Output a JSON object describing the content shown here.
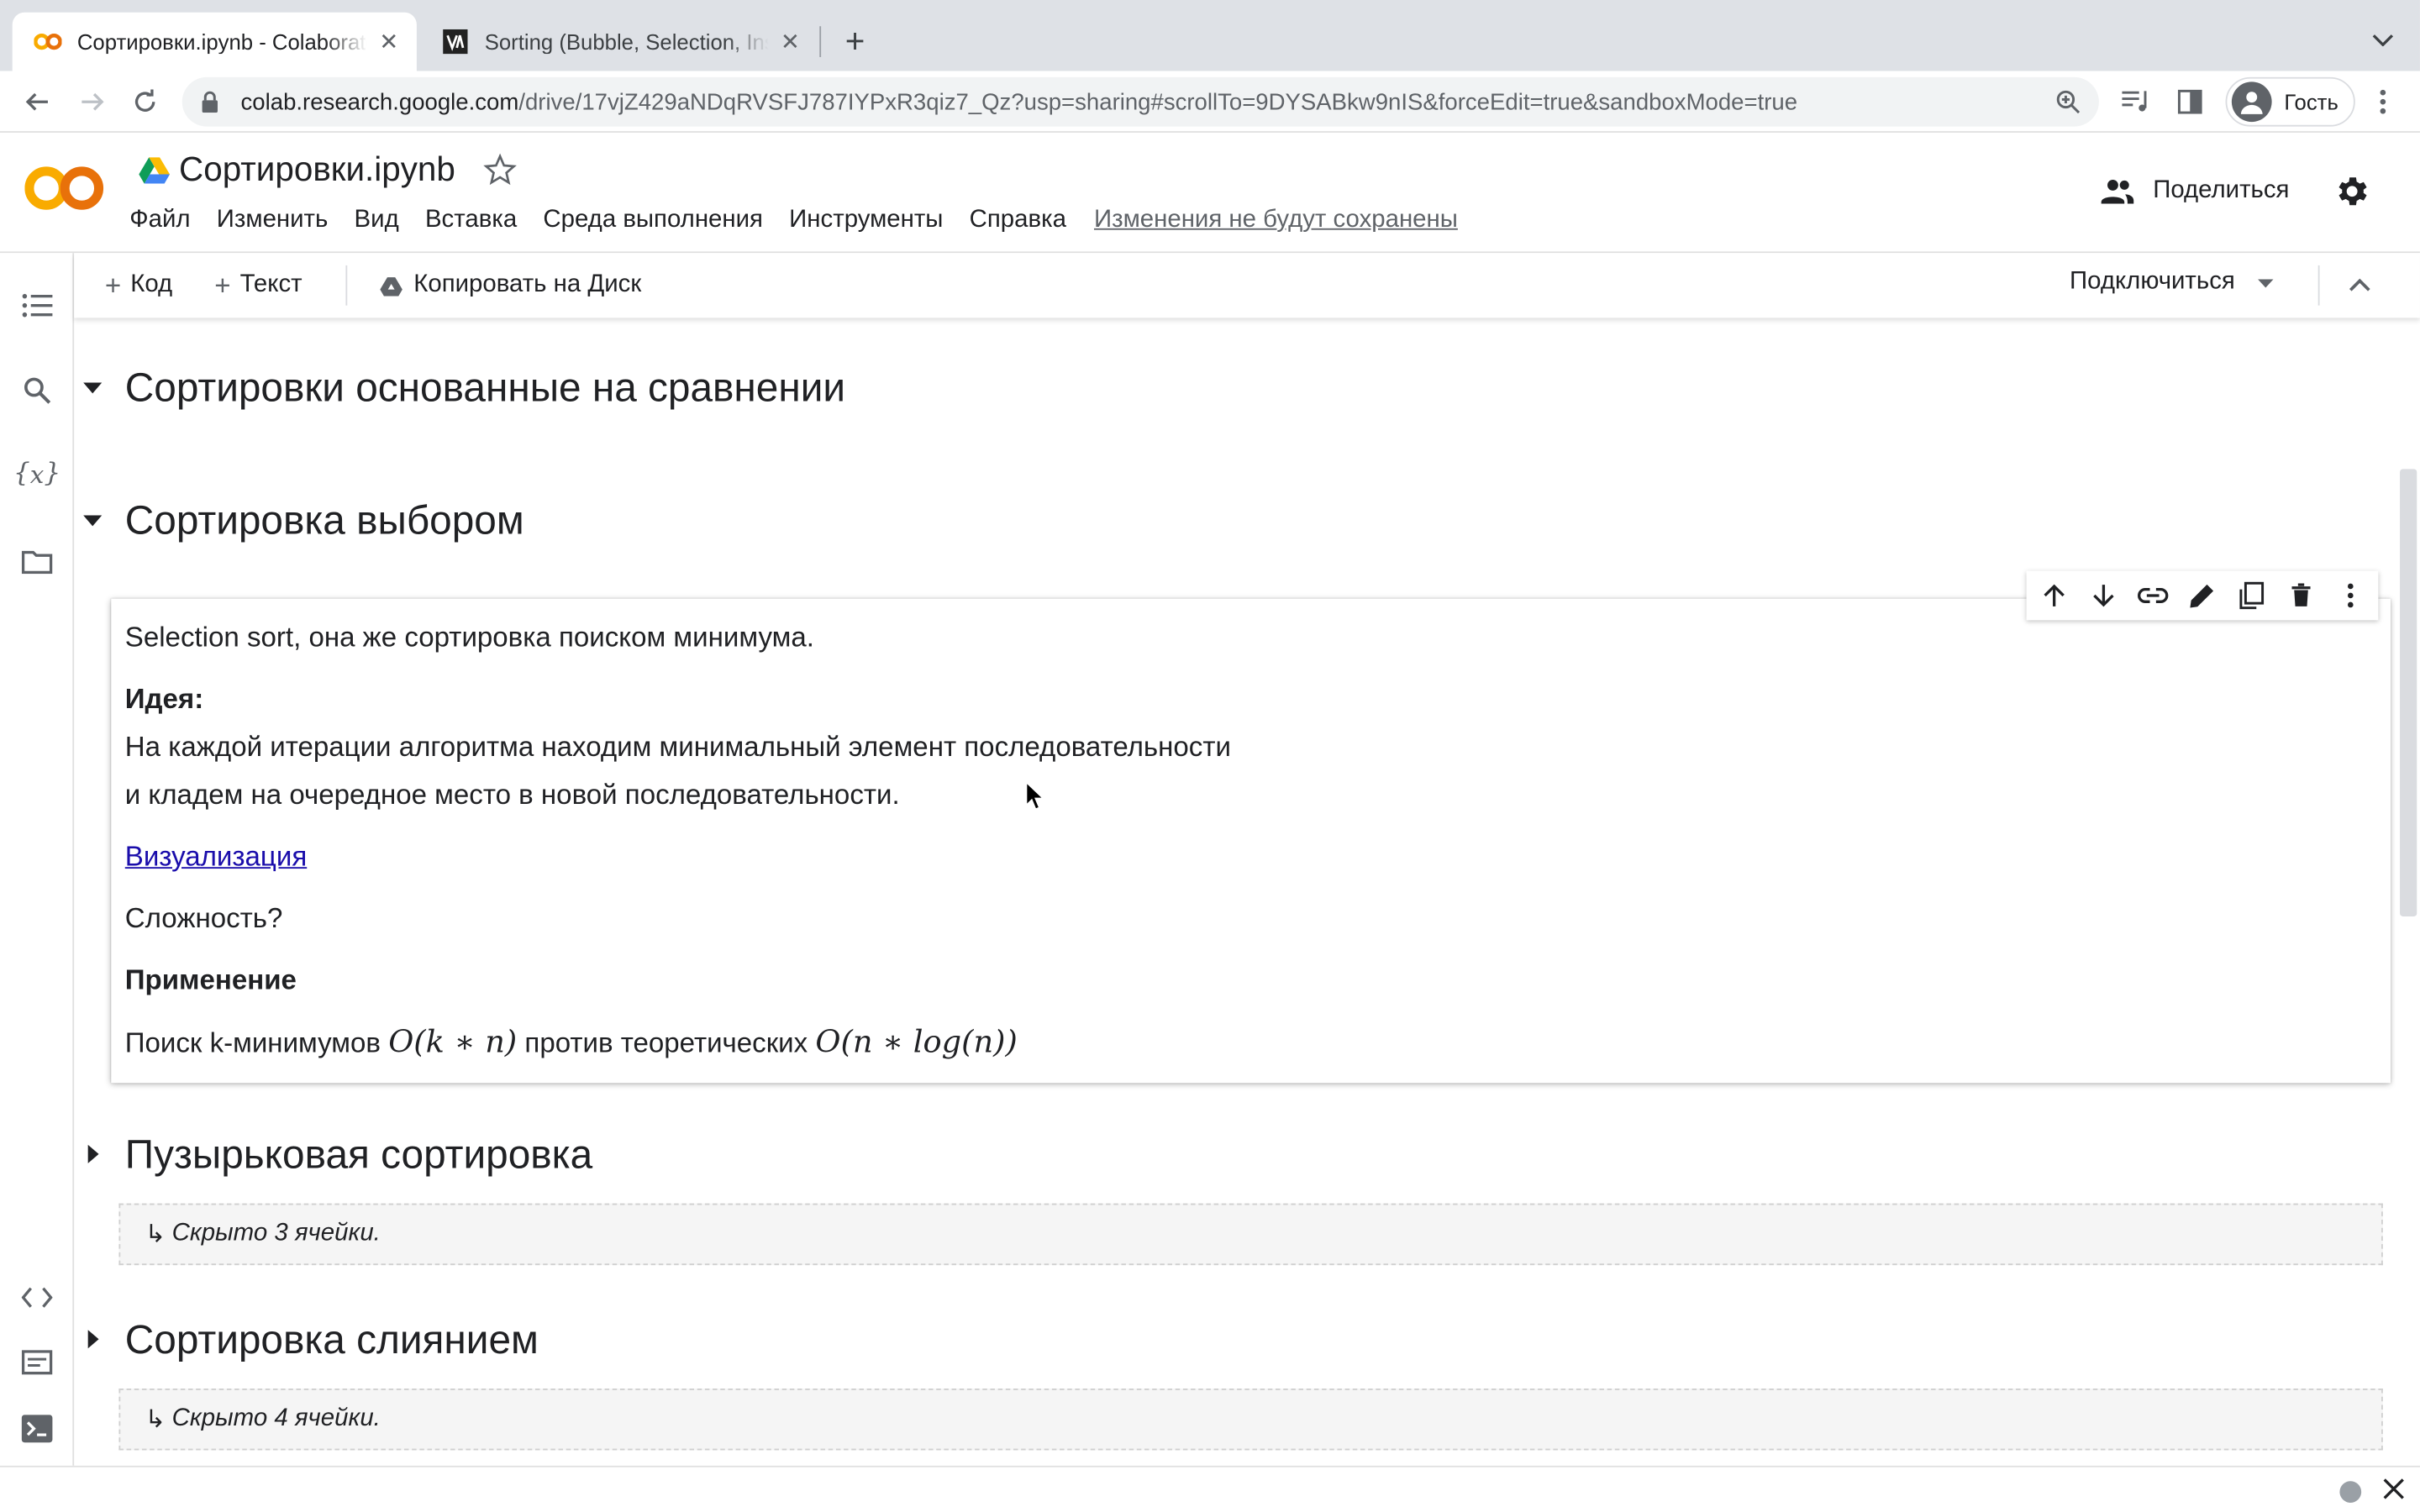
{
  "browser": {
    "tabs": [
      {
        "title": "Сортировки.ipynb - Colaboratory",
        "active": true
      },
      {
        "title": "Sorting (Bubble, Selection, Insertion)",
        "active": false
      }
    ],
    "url_host": "colab.research.google.com",
    "url_path": "/drive/17vjZ429aNDqRVSFJ787IYPxR3qiz7_Qz?usp=sharing#scrollTo=9DYSABkw9nIS&forceEdit=true&sandboxMode=true",
    "profile_label": "Гость"
  },
  "colab": {
    "notebook_title": "Сортировки.ipynb",
    "menu": [
      "Файл",
      "Изменить",
      "Вид",
      "Вставка",
      "Среда выполнения",
      "Инструменты",
      "Справка"
    ],
    "unsaved_notice": "Изменения не будут сохранены",
    "share_label": "Поделиться",
    "toolbar": {
      "add_code": "Код",
      "add_text": "Текст",
      "copy_to_drive": "Копировать на Диск",
      "connect": "Подключиться"
    }
  },
  "notebook": {
    "sections": [
      {
        "title": "Сортировки основанные на сравнении",
        "expanded": true
      },
      {
        "title": "Сортировка выбором",
        "expanded": true
      },
      {
        "title": "Пузырьковая сортировка",
        "expanded": false,
        "hidden_note": "Скрыто 3 ячейки."
      },
      {
        "title": "Сортировка слиянием",
        "expanded": false,
        "hidden_note": "Скрыто 4 ячейки."
      }
    ],
    "text_cell": {
      "intro": "Selection sort, она же сортировка поиском минимума.",
      "idea_label": "Идея:",
      "idea_line1": "На каждой итерации алгоритма находим минимальный элемент последовательности",
      "idea_line2": "и кладем на очередное место в новой последовательности.",
      "link": "Визуализация",
      "complexity_q": "Сложность?",
      "usage_label": "Применение",
      "usage_prefix": "Поиск k-минимумов",
      "usage_formula1": "O(k ∗ n)",
      "usage_middle": "против теоретических",
      "usage_formula2": "O(n ∗ log(n))"
    }
  }
}
